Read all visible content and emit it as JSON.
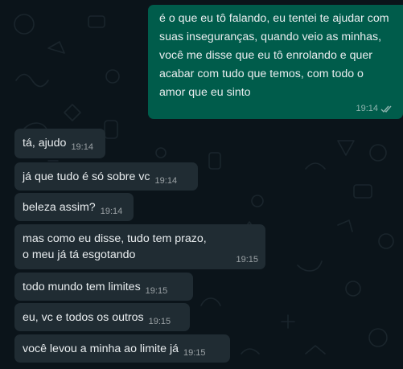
{
  "conversation": {
    "outgoing": {
      "text": "é o que eu tô falando, eu tentei te ajudar com suas inseguranças, quando veio as minhas, você me disse que eu tô enrolando e quer acabar com tudo que temos, com todo o amor que eu sinto",
      "time": "19:14",
      "status_icon": "double-check-icon"
    },
    "incoming": [
      {
        "text": "tá, ajudo",
        "time": "19:14"
      },
      {
        "text": "já que tudo é só sobre vc",
        "time": "19:14"
      },
      {
        "text": "beleza assim?",
        "time": "19:14"
      },
      {
        "text": "mas como eu disse, tudo tem prazo, o meu já tá esgotando",
        "time": "19:15"
      },
      {
        "text": "todo mundo tem limites",
        "time": "19:15"
      },
      {
        "text": "eu, vc e todos os outros",
        "time": "19:15"
      },
      {
        "text": "você levou a minha ao limite já",
        "time": "19:15"
      }
    ]
  },
  "colors": {
    "background": "#0b141a",
    "outgoing_bubble": "#005c4b",
    "incoming_bubble": "#202c33",
    "text": "#e9edef"
  }
}
